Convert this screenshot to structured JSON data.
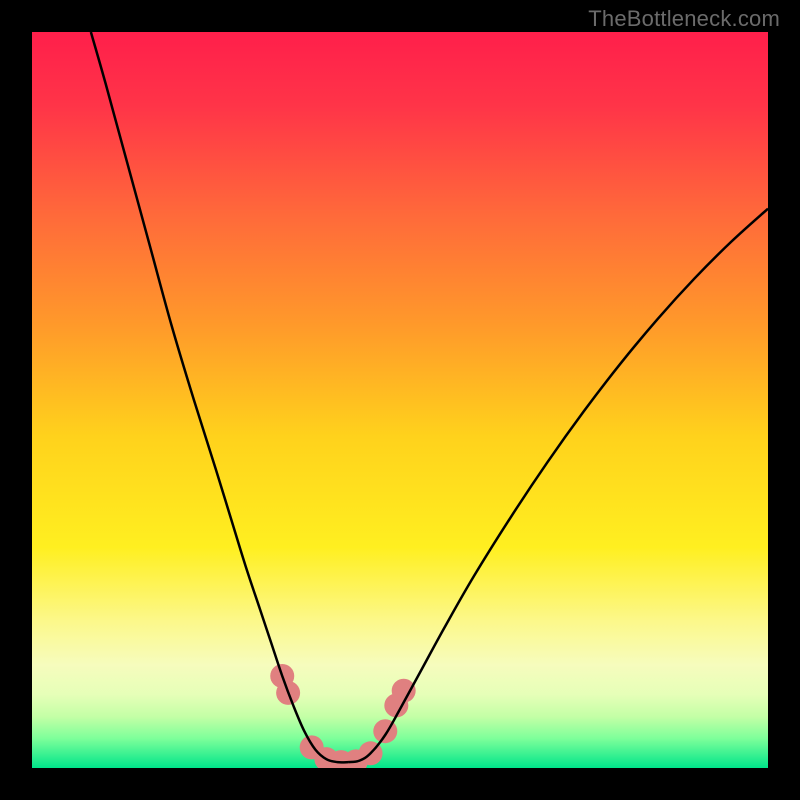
{
  "watermark": "TheBottleneck.com",
  "chart_data": {
    "type": "line",
    "title": "",
    "xlabel": "",
    "ylabel": "",
    "xlim": [
      0,
      100
    ],
    "ylim": [
      0,
      100
    ],
    "grid": false,
    "legend": false,
    "background_gradient": {
      "stops": [
        {
          "offset": 0.0,
          "color": "#ff1f4b"
        },
        {
          "offset": 0.1,
          "color": "#ff3448"
        },
        {
          "offset": 0.25,
          "color": "#ff6a3a"
        },
        {
          "offset": 0.4,
          "color": "#ff9a2a"
        },
        {
          "offset": 0.55,
          "color": "#ffd21c"
        },
        {
          "offset": 0.7,
          "color": "#ffef20"
        },
        {
          "offset": 0.8,
          "color": "#fcf88a"
        },
        {
          "offset": 0.86,
          "color": "#f6fcbd"
        },
        {
          "offset": 0.9,
          "color": "#e6ffb8"
        },
        {
          "offset": 0.93,
          "color": "#c4ffa6"
        },
        {
          "offset": 0.96,
          "color": "#7dff9a"
        },
        {
          "offset": 1.0,
          "color": "#00e58a"
        }
      ]
    },
    "series": [
      {
        "name": "left-curve",
        "color": "#000000",
        "stroke_width": 2.5,
        "points": [
          {
            "x": 8.0,
            "y": 100.0
          },
          {
            "x": 10.0,
            "y": 93.0
          },
          {
            "x": 13.0,
            "y": 82.0
          },
          {
            "x": 16.0,
            "y": 71.0
          },
          {
            "x": 19.0,
            "y": 60.0
          },
          {
            "x": 22.0,
            "y": 50.0
          },
          {
            "x": 25.0,
            "y": 40.5
          },
          {
            "x": 27.0,
            "y": 34.0
          },
          {
            "x": 29.0,
            "y": 27.5
          },
          {
            "x": 31.0,
            "y": 21.5
          },
          {
            "x": 32.5,
            "y": 17.0
          },
          {
            "x": 34.0,
            "y": 12.5
          },
          {
            "x": 35.5,
            "y": 8.5
          },
          {
            "x": 37.0,
            "y": 5.0
          },
          {
            "x": 38.5,
            "y": 2.5
          },
          {
            "x": 40.0,
            "y": 1.2
          },
          {
            "x": 41.5,
            "y": 0.8
          },
          {
            "x": 43.0,
            "y": 0.8
          }
        ]
      },
      {
        "name": "right-curve",
        "color": "#000000",
        "stroke_width": 2.5,
        "points": [
          {
            "x": 43.0,
            "y": 0.8
          },
          {
            "x": 44.5,
            "y": 1.0
          },
          {
            "x": 46.0,
            "y": 2.0
          },
          {
            "x": 48.0,
            "y": 4.5
          },
          {
            "x": 50.0,
            "y": 8.0
          },
          {
            "x": 53.0,
            "y": 13.5
          },
          {
            "x": 56.0,
            "y": 19.0
          },
          {
            "x": 60.0,
            "y": 26.0
          },
          {
            "x": 65.0,
            "y": 34.0
          },
          {
            "x": 70.0,
            "y": 41.5
          },
          {
            "x": 75.0,
            "y": 48.5
          },
          {
            "x": 80.0,
            "y": 55.0
          },
          {
            "x": 85.0,
            "y": 61.0
          },
          {
            "x": 90.0,
            "y": 66.5
          },
          {
            "x": 95.0,
            "y": 71.5
          },
          {
            "x": 100.0,
            "y": 76.0
          }
        ]
      }
    ],
    "markers": {
      "name": "valley-markers",
      "color": "#e08080",
      "radius_px": 12,
      "points": [
        {
          "x": 34.0,
          "y": 12.5
        },
        {
          "x": 34.8,
          "y": 10.2
        },
        {
          "x": 38.0,
          "y": 2.8
        },
        {
          "x": 40.0,
          "y": 1.2
        },
        {
          "x": 42.0,
          "y": 0.8
        },
        {
          "x": 44.0,
          "y": 0.9
        },
        {
          "x": 46.0,
          "y": 2.0
        },
        {
          "x": 48.0,
          "y": 5.0
        },
        {
          "x": 49.5,
          "y": 8.5
        },
        {
          "x": 50.5,
          "y": 10.5
        }
      ]
    }
  }
}
